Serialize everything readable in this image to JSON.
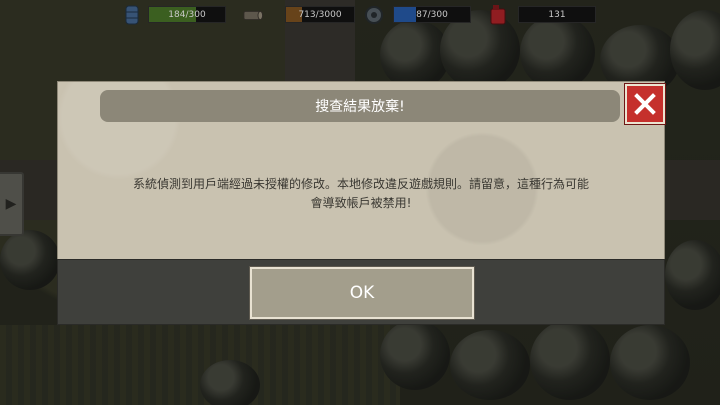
{
  "resources": [
    {
      "icon": "water-barrel-icon",
      "value": "184/300",
      "fill": 0.613,
      "color": "#4f7f2b"
    },
    {
      "icon": "log-wood-icon",
      "value": "713/3000",
      "fill": 0.238,
      "color": "#8a5a23"
    },
    {
      "icon": "gear-cog-icon",
      "value": "87/300",
      "fill": 0.29,
      "color": "#2a63b8"
    },
    {
      "icon": "fuel-canister-icon",
      "value": "131",
      "fill": 0,
      "color": "#c1272d"
    }
  ],
  "dialog": {
    "title": "搜查結果放棄!",
    "message_line1": "系統偵測到用戶端經過未授權的修改。本地修改違反遊戲規則。請留意，這種行為可能",
    "message_line2": "會導致帳戶被禁用!",
    "ok_label": "OK",
    "close_icon": "close-x-icon"
  },
  "colors": {
    "title_bar": "#8c8778",
    "close_button": "#c5302c",
    "paper": "#c9c2b0",
    "footer": "#3f403c",
    "ok_button": "#a39e8c"
  }
}
